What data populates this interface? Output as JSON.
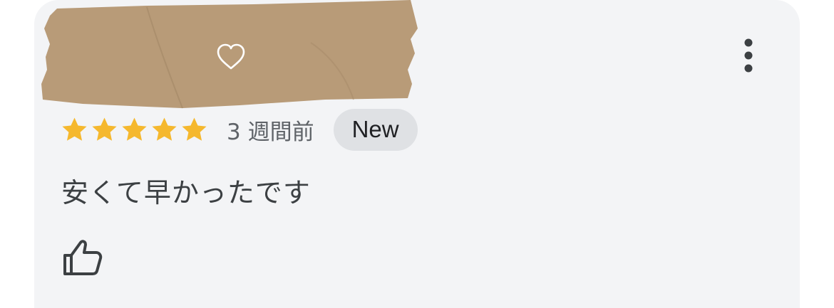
{
  "review": {
    "rating": 5,
    "max_rating": 5,
    "time_ago": "3 週間前",
    "badge": "New",
    "text": "安くて早かったです"
  },
  "colors": {
    "card_bg": "#f3f4f6",
    "star": "#f5b82e",
    "tape": "#b89b78",
    "badge_bg": "#dfe1e4",
    "icon": "#3c4043"
  },
  "icons": {
    "heart": "heart-outline-icon",
    "more": "more-vert-icon",
    "like": "thumbs-up-icon"
  }
}
